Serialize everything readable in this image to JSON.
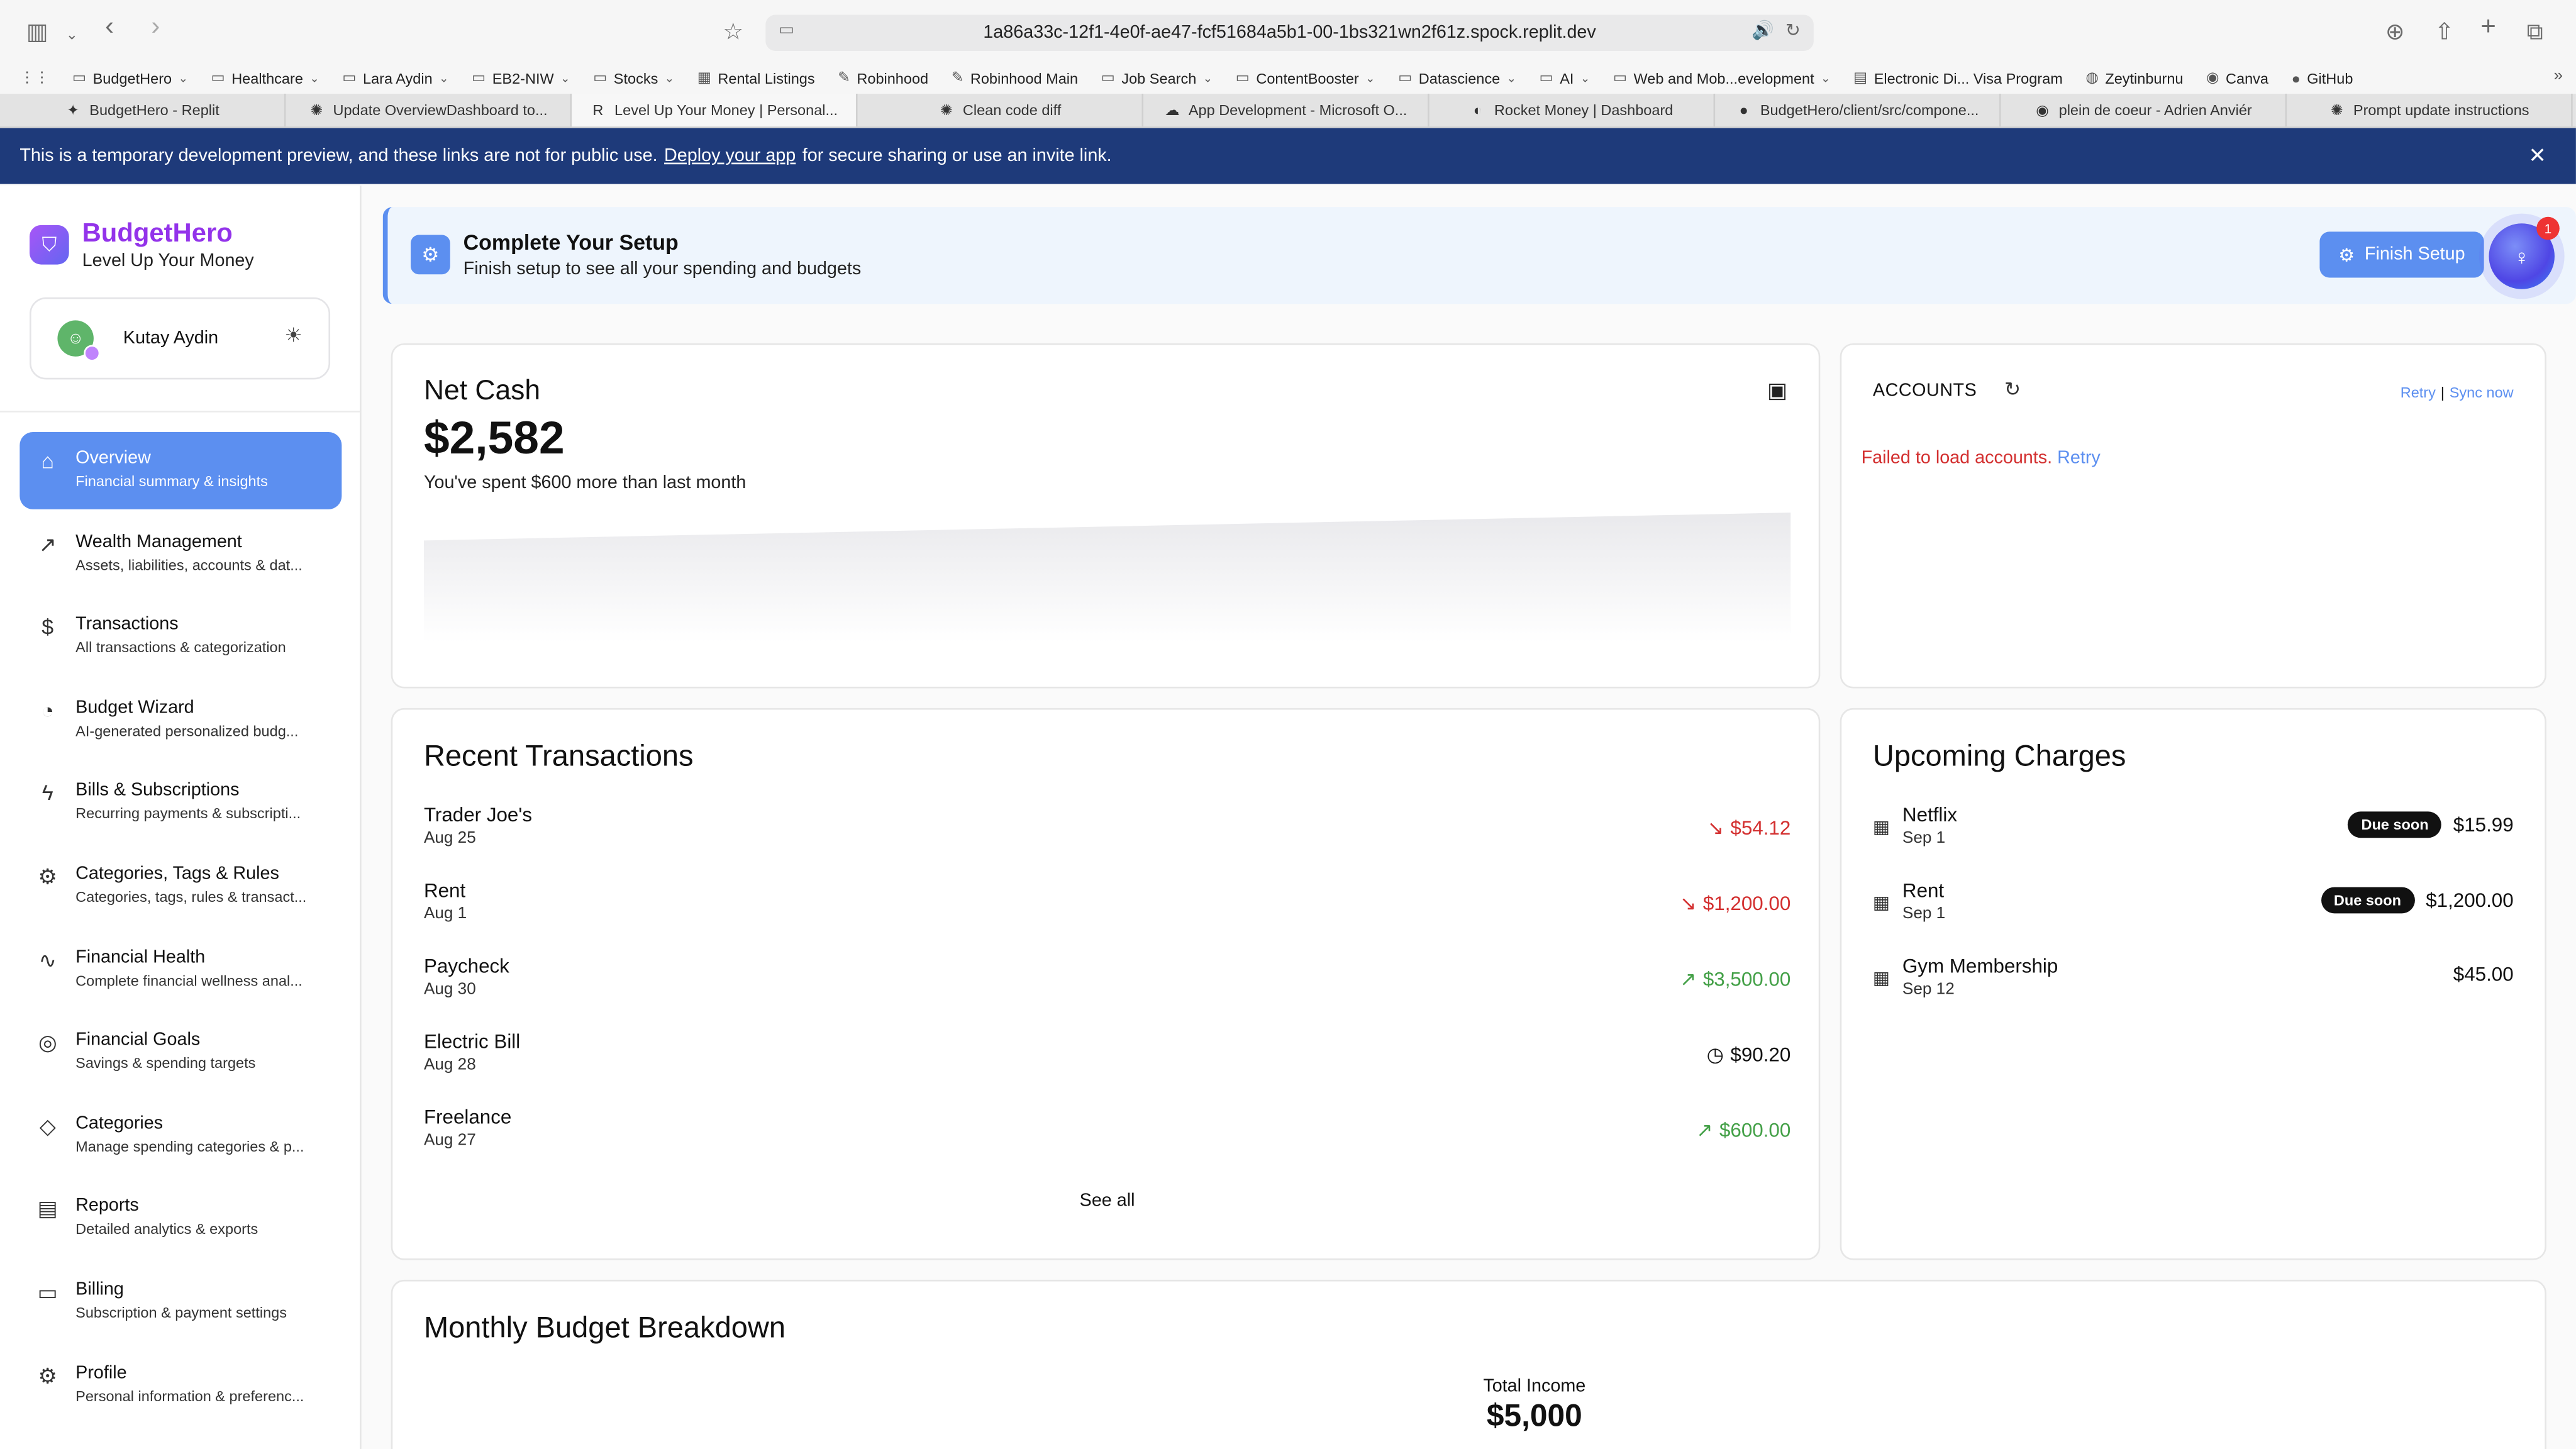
{
  "browser": {
    "url": "1a86a33c-12f1-4e0f-ae47-fcf51684a5b1-00-1bs321wn2f61z.spock.replit.dev",
    "bookmarks": [
      {
        "label": "BudgetHero",
        "icon": "folder-icon",
        "has_menu": true
      },
      {
        "label": "Healthcare",
        "icon": "folder-icon",
        "has_menu": true
      },
      {
        "label": "Lara Aydin",
        "icon": "folder-icon",
        "has_menu": true
      },
      {
        "label": "EB2-NIW",
        "icon": "folder-icon",
        "has_menu": true
      },
      {
        "label": "Stocks",
        "icon": "folder-icon",
        "has_menu": true
      },
      {
        "label": "Rental Listings",
        "icon": "site-icon",
        "has_menu": false
      },
      {
        "label": "Robinhood",
        "icon": "feather-icon",
        "has_menu": false
      },
      {
        "label": "Robinhood Main",
        "icon": "feather-icon",
        "has_menu": false
      },
      {
        "label": "Job Search",
        "icon": "folder-icon",
        "has_menu": true
      },
      {
        "label": "ContentBooster",
        "icon": "folder-icon",
        "has_menu": true
      },
      {
        "label": "Datascience",
        "icon": "folder-icon",
        "has_menu": true
      },
      {
        "label": "AI",
        "icon": "folder-icon",
        "has_menu": true
      },
      {
        "label": "Web and Mob...evelopment",
        "icon": "folder-icon",
        "has_menu": true
      },
      {
        "label": "Electronic Di... Visa Program",
        "icon": "doc-icon",
        "has_menu": false
      },
      {
        "label": "Zeytinburnu",
        "icon": "globe-icon",
        "has_menu": false
      },
      {
        "label": "Canva",
        "icon": "canva-icon",
        "has_menu": false
      },
      {
        "label": "GitHub",
        "icon": "github-icon",
        "has_menu": false
      }
    ],
    "tabs": [
      {
        "label": "BudgetHero - Replit",
        "icon": "replit-icon",
        "active": false
      },
      {
        "label": "Update OverviewDashboard to...",
        "icon": "openai-icon",
        "active": false
      },
      {
        "label": "Level Up Your Money | Personal...",
        "icon": "r-icon",
        "active": true
      },
      {
        "label": "Clean code diff",
        "icon": "openai-icon",
        "active": false
      },
      {
        "label": "App Development - Microsoft O...",
        "icon": "cloud-icon",
        "active": false
      },
      {
        "label": "Rocket Money | Dashboard",
        "icon": "rocket-icon",
        "active": false
      },
      {
        "label": "BudgetHero/client/src/compone...",
        "icon": "github-icon",
        "active": false
      },
      {
        "label": "plein de coeur - Adrien Anviér",
        "icon": "spotify-icon",
        "active": false
      },
      {
        "label": "Prompt update instructions",
        "icon": "openai-icon",
        "active": false
      }
    ]
  },
  "banner": {
    "text_before": "This is a temporary development preview, and these links are not for public use.",
    "link": "Deploy your app",
    "text_after": "for secure sharing or use an invite link."
  },
  "sidebar": {
    "brand": {
      "name": "BudgetHero",
      "tagline": "Level Up Your Money"
    },
    "user": {
      "name": "Kutay Aydin"
    },
    "items": [
      {
        "title": "Overview",
        "subtitle": "Financial summary & insights",
        "icon": "home-icon",
        "active": true
      },
      {
        "title": "Wealth Management",
        "subtitle": "Assets, liabilities, accounts & dat...",
        "icon": "trending-up-icon",
        "active": false
      },
      {
        "title": "Transactions",
        "subtitle": "All transactions & categorization",
        "icon": "dollar-icon",
        "active": false
      },
      {
        "title": "Budget Wizard",
        "subtitle": "AI-generated personalized budg...",
        "icon": "pie-chart-icon",
        "active": false
      },
      {
        "title": "Bills & Subscriptions",
        "subtitle": "Recurring payments & subscripti...",
        "icon": "lightning-icon",
        "active": false
      },
      {
        "title": "Categories, Tags & Rules",
        "subtitle": "Categories, tags, rules & transact...",
        "icon": "gear-icon",
        "active": false
      },
      {
        "title": "Financial Health",
        "subtitle": "Complete financial wellness anal...",
        "icon": "activity-icon",
        "active": false
      },
      {
        "title": "Financial Goals",
        "subtitle": "Savings & spending targets",
        "icon": "target-icon",
        "active": false
      },
      {
        "title": "Categories",
        "subtitle": "Manage spending categories & p...",
        "icon": "tag-icon",
        "active": false
      },
      {
        "title": "Reports",
        "subtitle": "Detailed analytics & exports",
        "icon": "document-icon",
        "active": false
      },
      {
        "title": "Billing",
        "subtitle": "Subscription & payment settings",
        "icon": "credit-card-icon",
        "active": false
      },
      {
        "title": "Profile",
        "subtitle": "Personal information & preferenc...",
        "icon": "gear-icon",
        "active": false
      }
    ]
  },
  "setup": {
    "title": "Complete Your Setup",
    "subtitle": "Finish setup to see all your spending and budgets",
    "button": "Finish Setup",
    "notification_count": "1"
  },
  "net_cash": {
    "title": "Net Cash",
    "value": "$2,582",
    "subtitle": "You've spent $600 more than last month"
  },
  "accounts": {
    "title": "ACCOUNTS",
    "retry_link": "Retry",
    "sync_link": "Sync now",
    "error": "Failed to load accounts.",
    "error_retry": "Retry"
  },
  "recent_transactions": {
    "title": "Recent Transactions",
    "items": [
      {
        "name": "Trader Joe's",
        "date": "Aug 25",
        "amount": "$54.12",
        "type": "expense"
      },
      {
        "name": "Rent",
        "date": "Aug 1",
        "amount": "$1,200.00",
        "type": "expense"
      },
      {
        "name": "Paycheck",
        "date": "Aug 30",
        "amount": "$3,500.00",
        "type": "income"
      },
      {
        "name": "Electric Bill",
        "date": "Aug 28",
        "amount": "$90.20",
        "type": "pending"
      },
      {
        "name": "Freelance",
        "date": "Aug 27",
        "amount": "$600.00",
        "type": "income"
      }
    ],
    "see_all": "See all"
  },
  "upcoming_charges": {
    "title": "Upcoming Charges",
    "items": [
      {
        "name": "Netflix",
        "date": "Sep 1",
        "badge": "Due soon",
        "amount": "$15.99"
      },
      {
        "name": "Rent",
        "date": "Sep 1",
        "badge": "Due soon",
        "amount": "$1,200.00"
      },
      {
        "name": "Gym Membership",
        "date": "Sep 12",
        "badge": "",
        "amount": "$45.00"
      }
    ]
  },
  "budget_breakdown": {
    "title": "Monthly Budget Breakdown",
    "total_income_label": "Total Income",
    "total_income_value": "$5,000"
  },
  "colors": {
    "accent": "#5c8ff0",
    "brand": "#9333ea",
    "expense": "#d32f2f",
    "income": "#43a047",
    "banner": "#1e3a7a"
  }
}
